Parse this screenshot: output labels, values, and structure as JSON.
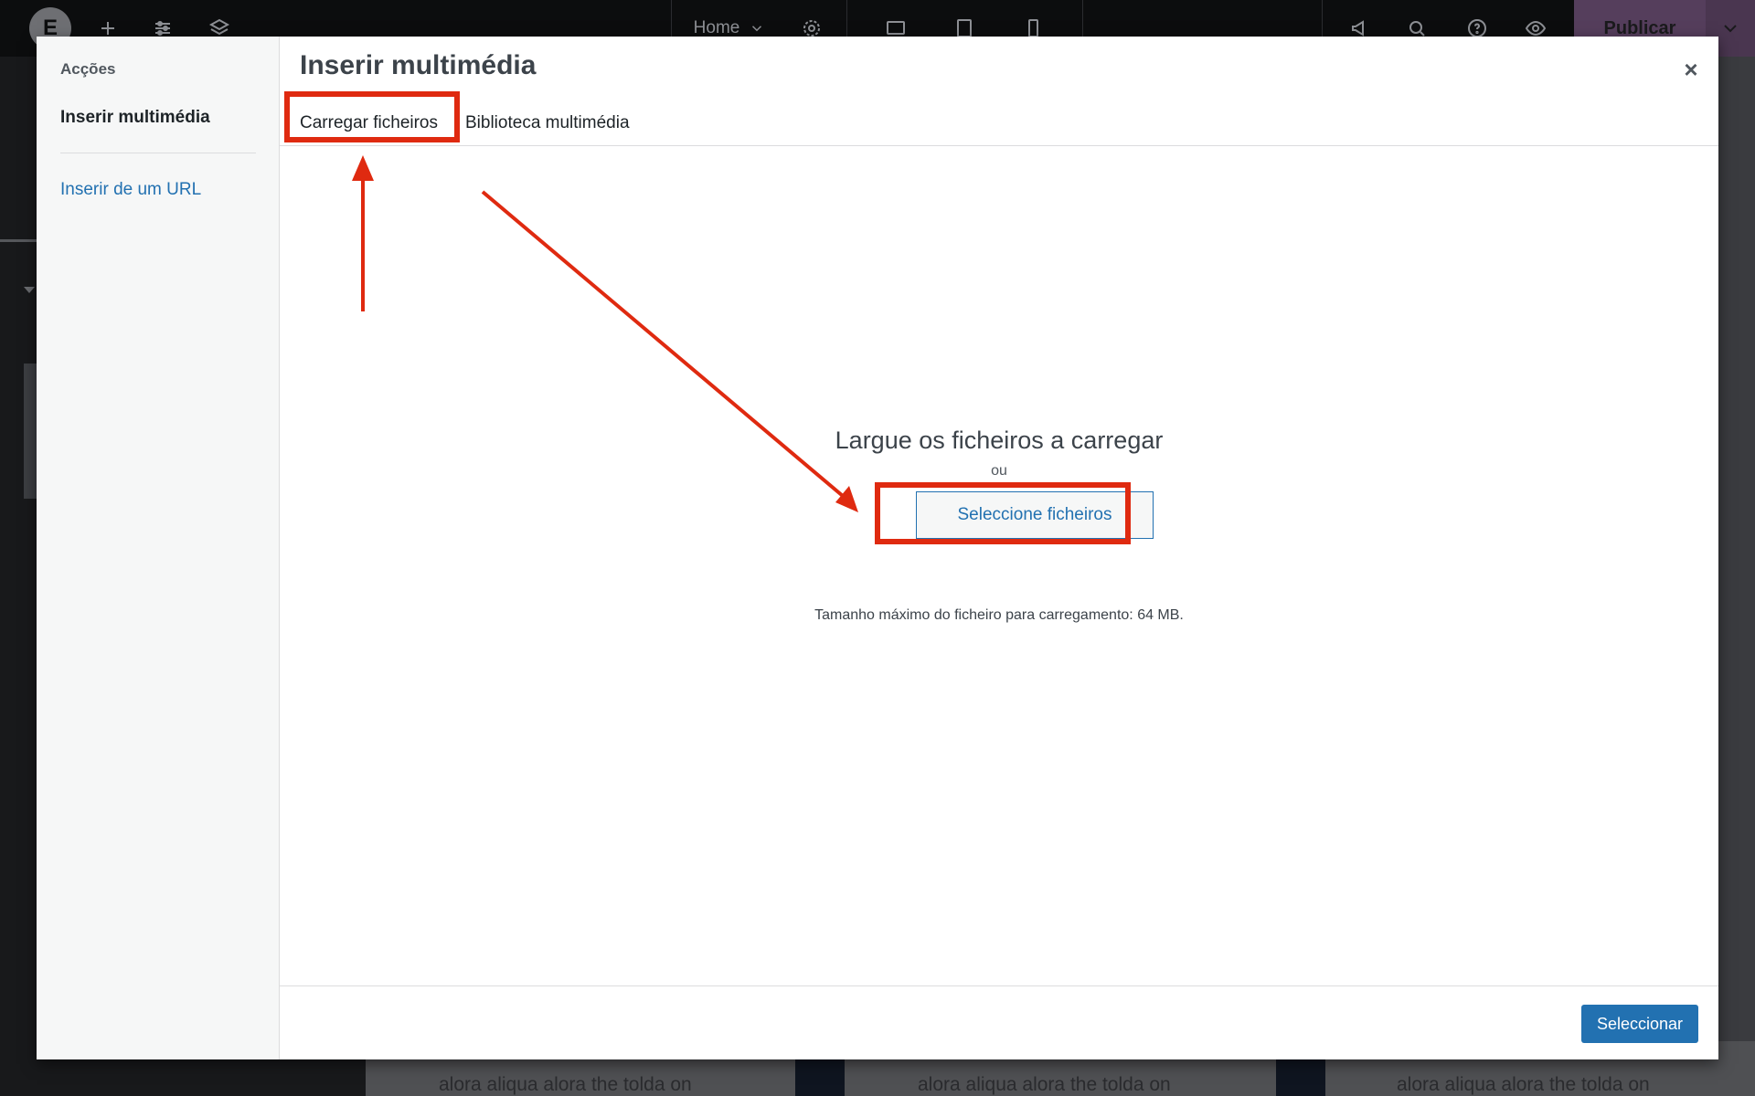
{
  "editor": {
    "home_label": "Home",
    "publish_label": "Publicar",
    "canvas_snippet": "alora aliqua alora the tolda on"
  },
  "modal": {
    "title": "Inserir multimédia",
    "close_glyph": "×",
    "menu": {
      "heading": "Acções",
      "active_item": "Inserir multimédia",
      "url_item": "Inserir de um URL"
    },
    "tabs": {
      "upload": "Carregar ficheiros",
      "library": "Biblioteca multimédia"
    },
    "uploader": {
      "drop_title": "Largue os ficheiros a carregar",
      "or": "ou",
      "select_files": "Seleccione ficheiros",
      "max_size": "Tamanho máximo do ficheiro para carregamento: 64 MB."
    },
    "select_button": "Seleccionar"
  },
  "colors": {
    "annotation_red": "#df2a10",
    "wp_blue": "#2271b1",
    "publish_bg": "#553e5c"
  },
  "icons": [
    "elementor-logo-icon",
    "plus-icon",
    "sliders-icon",
    "layers-icon",
    "chevron-down-icon",
    "gear-icon",
    "desktop-icon",
    "tablet-icon",
    "mobile-icon",
    "megaphone-icon",
    "search-icon",
    "help-icon",
    "eye-icon",
    "close-icon"
  ]
}
